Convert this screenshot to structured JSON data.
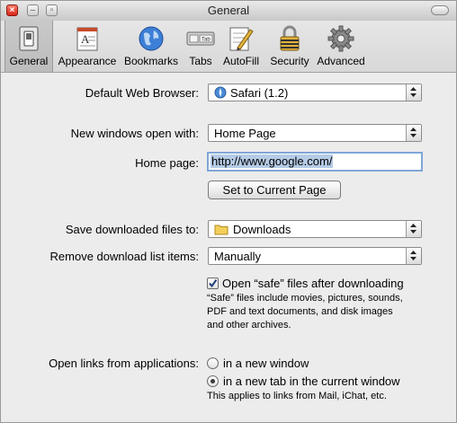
{
  "window": {
    "title": "General"
  },
  "toolbar": {
    "items": [
      {
        "label": "General",
        "icon": "general-switch-icon"
      },
      {
        "label": "Appearance",
        "icon": "appearance-icon"
      },
      {
        "label": "Bookmarks",
        "icon": "bookmarks-globe-icon"
      },
      {
        "label": "Tabs",
        "icon": "tabs-icon"
      },
      {
        "label": "AutoFill",
        "icon": "autofill-pencil-icon"
      },
      {
        "label": "Security",
        "icon": "security-lock-icon"
      },
      {
        "label": "Advanced",
        "icon": "advanced-gear-icon"
      }
    ],
    "selected": "General",
    "tabs_icon_text": "Tab"
  },
  "form": {
    "default_browser_label": "Default Web Browser:",
    "default_browser_value": "Safari (1.2)",
    "new_windows_label": "New windows open with:",
    "new_windows_value": "Home Page",
    "home_page_label": "Home page:",
    "home_page_value": "http://www.google.com/",
    "set_current_button": "Set to Current Page",
    "save_downloads_label": "Save downloaded files to:",
    "save_downloads_value": "Downloads",
    "remove_download_label": "Remove download list items:",
    "remove_download_value": "Manually",
    "open_safe_label": "Open “safe” files after downloading",
    "open_safe_checked": true,
    "safe_note": "“Safe” files include movies, pictures, sounds,\nPDF and text documents, and disk images\nand other archives.",
    "open_links_label": "Open links from applications:",
    "open_links_option1": "in a new window",
    "open_links_option2": "in a new tab in the current window",
    "open_links_selected": "in a new tab in the current window",
    "links_note": "This applies to links from Mail, iChat, etc."
  }
}
